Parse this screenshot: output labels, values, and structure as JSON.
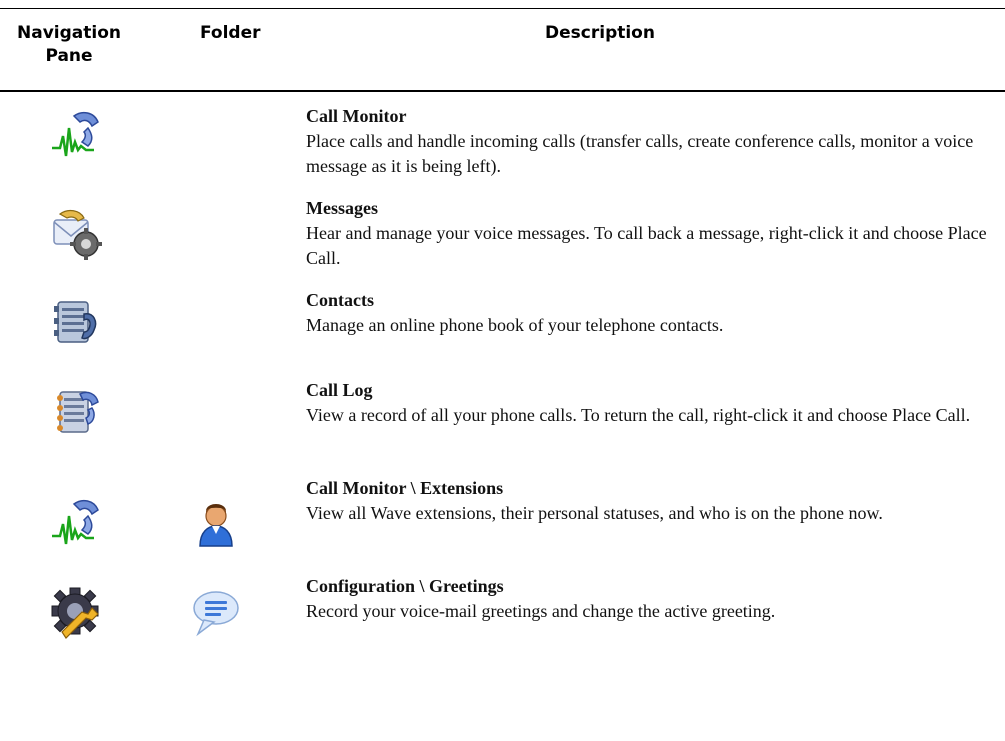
{
  "header": {
    "col_nav": "Navigation\nPane",
    "col_folder": "Folder",
    "col_desc": "Description"
  },
  "rows": [
    {
      "nav_icon": "call-monitor-icon",
      "folder_icon": "",
      "title": "Call Monitor",
      "text": "Place calls and handle incoming calls (transfer calls, create conference calls, monitor a voice message as it is being left)."
    },
    {
      "nav_icon": "messages-icon",
      "folder_icon": "",
      "title": "Messages",
      "text": "Hear and manage your voice messages. To call back a message, right-click it and choose Place Call."
    },
    {
      "nav_icon": "contacts-icon",
      "folder_icon": "",
      "title": "Contacts",
      "text": "Manage an online phone book of your telephone contacts."
    },
    {
      "nav_icon": "call-log-icon",
      "folder_icon": "",
      "title": "Call Log",
      "text": "View a record of all your phone calls. To return the call, right-click it and choose Place Call."
    },
    {
      "nav_icon": "call-monitor-icon",
      "folder_icon": "extensions-person-icon",
      "title": "Call Monitor \\ Extensions",
      "text": "View all Wave extensions, their personal statuses, and who is on the phone now."
    },
    {
      "nav_icon": "configuration-gear-icon",
      "folder_icon": "greetings-speech-bubble-icon",
      "title": "Configuration \\ Greetings",
      "text": "Record your voice-mail greetings and change the active greeting."
    }
  ]
}
